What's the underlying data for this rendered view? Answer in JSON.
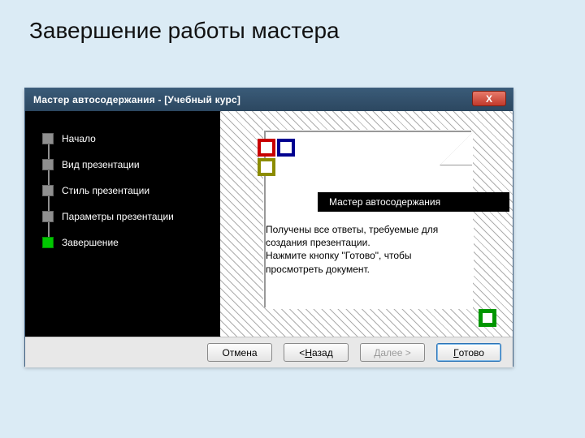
{
  "page": {
    "title": "Завершение работы мастера"
  },
  "window": {
    "title": "Мастер автосодержания - [Учебный курс]",
    "close": "X"
  },
  "steps": [
    {
      "label": "Начало",
      "active": false
    },
    {
      "label": "Вид презентации",
      "active": false
    },
    {
      "label": "Стиль презентации",
      "active": false
    },
    {
      "label": "Параметры презентации",
      "active": false
    },
    {
      "label": "Завершение",
      "active": true
    }
  ],
  "stripe": "Мастер автосодержания",
  "body": {
    "l1": "Получены все ответы, требуемые для",
    "l2": "создания презентации.",
    "l3": "Нажмите кнопку \"Готово\", чтобы",
    "l4": "просмотреть документ."
  },
  "colors": {
    "c1": "#c80000",
    "c2": "#000090",
    "c3": "#8c8c00"
  },
  "buttons": {
    "cancel": "Отмена",
    "back_lt": "< ",
    "back_u": "Н",
    "back_rest": "азад",
    "next_u": "Д",
    "next_rest": "алее >",
    "finish_u": "Г",
    "finish_rest": "отово"
  }
}
